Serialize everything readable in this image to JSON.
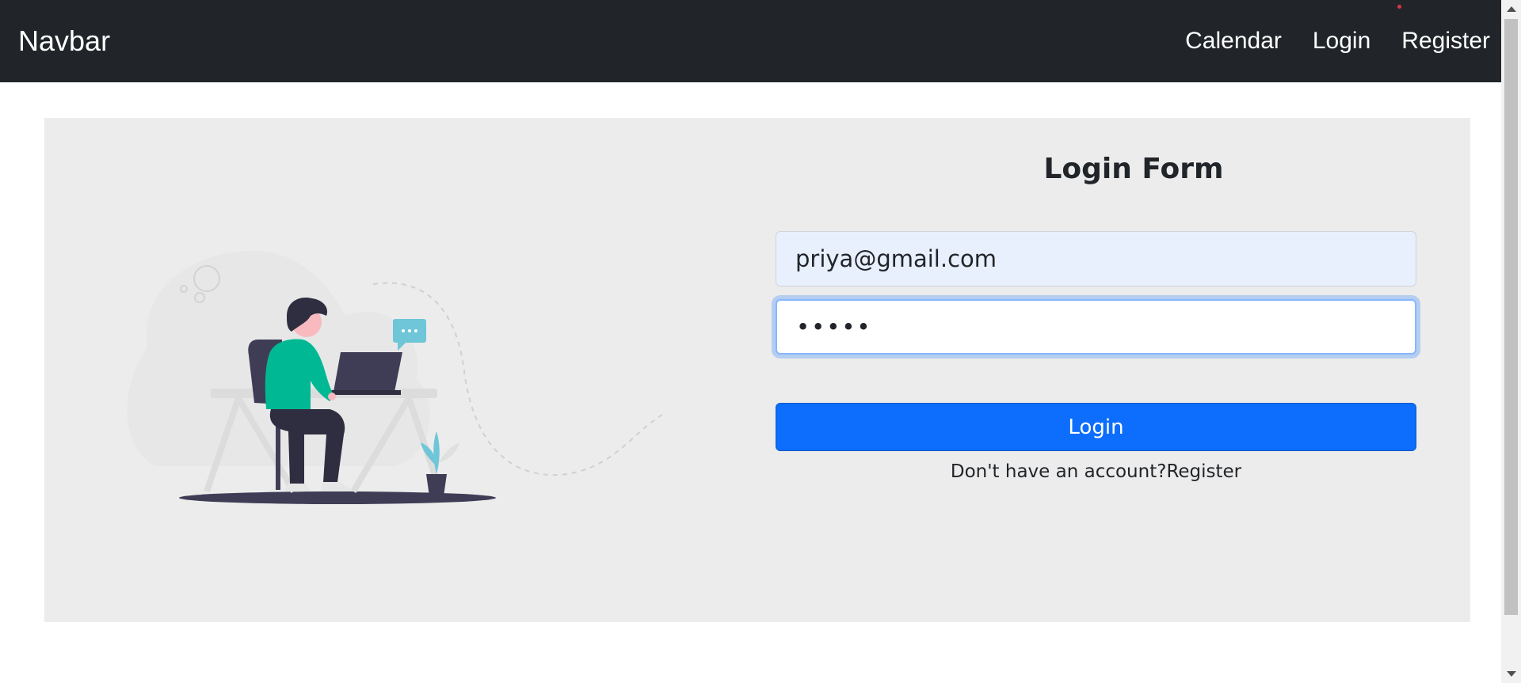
{
  "navbar": {
    "brand": "Navbar",
    "links": [
      "Calendar",
      "Login",
      "Register"
    ]
  },
  "form": {
    "title": "Login Form",
    "email_value": "priya@gmail.com",
    "password_value": "•••••",
    "submit_label": "Login",
    "prompt_text": "Don't have an account?",
    "register_link": "Register"
  },
  "colors": {
    "navbar_bg": "#212529",
    "panel_bg": "#ececec",
    "primary": "#0d6efd",
    "autofill_bg": "#e8f0fe",
    "illustration_accent": "#00b894"
  },
  "icons": {
    "illustration": "person-at-laptop-illustration"
  }
}
